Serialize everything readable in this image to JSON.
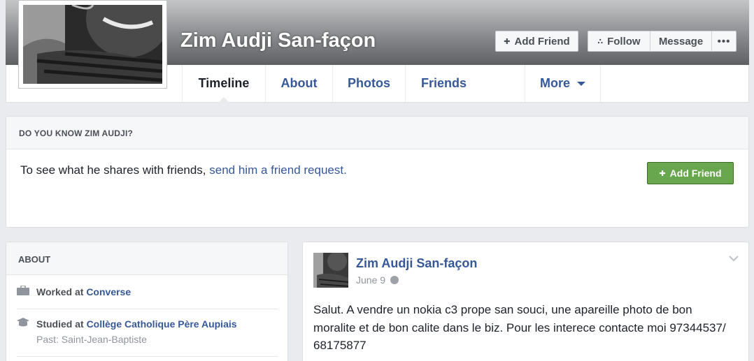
{
  "profile": {
    "name": "Zim Audji San-façon"
  },
  "header_buttons": {
    "add_friend": "Add Friend",
    "follow": "Follow",
    "message": "Message",
    "more": "•••"
  },
  "tabs": [
    {
      "label": "Timeline",
      "active": true
    },
    {
      "label": "About"
    },
    {
      "label": "Photos"
    },
    {
      "label": "Friends"
    },
    {
      "label": "More"
    }
  ],
  "do_you_know": {
    "heading": "DO YOU KNOW ZIM AUDJI?",
    "text": "To see what he shares with friends, ",
    "link": "send him a friend request.",
    "button": "Add Friend"
  },
  "about": {
    "heading": "ABOUT",
    "work_prefix": "Worked at ",
    "work_place": "Converse",
    "study_prefix": "Studied at ",
    "study_place": "Collège Catholique Père Aupiais",
    "study_past": "Past: Saint-Jean-Baptiste"
  },
  "post": {
    "author": "Zim Audji San-façon",
    "date": "June 9",
    "text": "Salut. A vendre un nokia c3 prope san souci, une apareille photo de bon moralite et de bon calite dans le biz. Pour les interece contacte moi 97344537/ 68175877"
  },
  "colors": {
    "link": "#365899",
    "green_button": "#69a74e",
    "page_bg": "#e9ebee"
  }
}
